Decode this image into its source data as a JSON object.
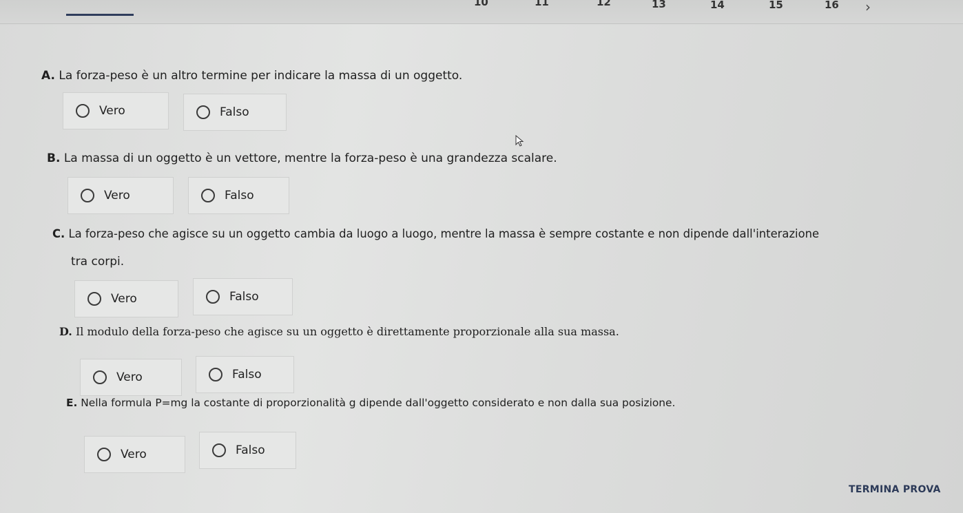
{
  "nav": {
    "numbers": [
      "10",
      "11",
      "12",
      "13",
      "14",
      "15",
      "16"
    ],
    "next_glyph": "›"
  },
  "questions": [
    {
      "letter": "A.",
      "text": "La forza-peso è un altro termine per indicare la massa di un oggetto.",
      "options": [
        "Vero",
        "Falso"
      ]
    },
    {
      "letter": "B.",
      "text": "La massa di un oggetto è un vettore, mentre la forza-peso è una grandezza scalare.",
      "options": [
        "Vero",
        "Falso"
      ]
    },
    {
      "letter": "C.",
      "text": "La forza-peso che agisce su un oggetto cambia da luogo a luogo, mentre la massa è sempre costante e non dipende dall'interazione",
      "text_line2": "tra corpi.",
      "options": [
        "Vero",
        "Falso"
      ]
    },
    {
      "letter": "D.",
      "text": "Il modulo della forza-peso che agisce su un oggetto è direttamente proporzionale alla sua massa.",
      "options": [
        "Vero",
        "Falso"
      ]
    },
    {
      "letter": "E.",
      "text": "Nella formula P=mg la costante di proporzionalità g dipende dall'oggetto considerato e non dalla sua posizione.",
      "options": [
        "Vero",
        "Falso"
      ]
    }
  ],
  "footer": {
    "finish_label": "TERMINA PROVA"
  },
  "colors": {
    "accent": "#2f3d5c",
    "background": "#dcdddc"
  }
}
